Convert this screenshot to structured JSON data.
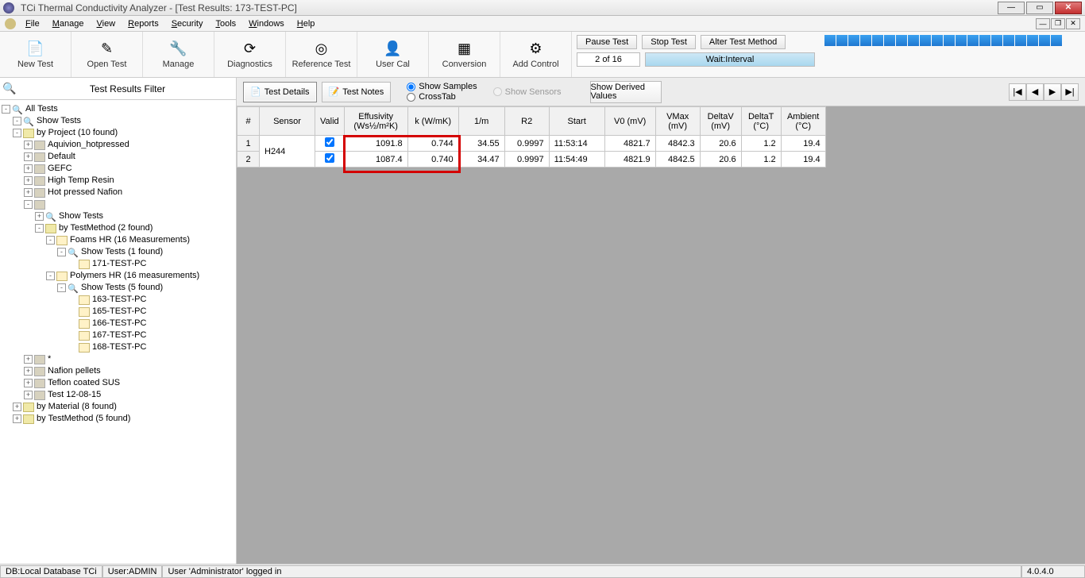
{
  "title": "TCi Thermal Conductivity Analyzer - [Test Results: 173-TEST-PC]",
  "menu": [
    "File",
    "Manage",
    "View",
    "Reports",
    "Security",
    "Tools",
    "Windows",
    "Help"
  ],
  "toolbar": [
    {
      "label": "New Test",
      "icon": "📄"
    },
    {
      "label": "Open Test",
      "icon": "✎"
    },
    {
      "label": "Manage",
      "icon": "🔧"
    },
    {
      "label": "Diagnostics",
      "icon": "⟳"
    },
    {
      "label": "Reference Test",
      "icon": "◎"
    },
    {
      "label": "User Cal",
      "icon": "👤"
    },
    {
      "label": "Conversion",
      "icon": "▦"
    },
    {
      "label": "Add Control",
      "icon": "⚙"
    }
  ],
  "right_buttons": {
    "pause": "Pause Test",
    "stop": "Stop Test",
    "alter": "Alter Test Method"
  },
  "status": {
    "count": "2 of 16",
    "wait": "Wait:Interval"
  },
  "filter_label": "Test Results Filter",
  "tree": [
    {
      "d": 0,
      "exp": "-",
      "icon": "search",
      "label": "All Tests"
    },
    {
      "d": 1,
      "exp": "-",
      "icon": "search",
      "label": "Show Tests"
    },
    {
      "d": 1,
      "exp": "-",
      "icon": "folder",
      "label": "by Project (10 found)"
    },
    {
      "d": 2,
      "exp": "+",
      "icon": "nicon",
      "label": "Aquivion_hotpressed"
    },
    {
      "d": 2,
      "exp": "+",
      "icon": "nicon",
      "label": "Default"
    },
    {
      "d": 2,
      "exp": "+",
      "icon": "nicon",
      "label": "GEFC"
    },
    {
      "d": 2,
      "exp": "+",
      "icon": "nicon",
      "label": "High Temp Resin"
    },
    {
      "d": 2,
      "exp": "+",
      "icon": "nicon",
      "label": "Hot pressed Nafion"
    },
    {
      "d": 2,
      "exp": "-",
      "icon": "nicon",
      "label": ""
    },
    {
      "d": 3,
      "exp": "+",
      "icon": "search",
      "label": "Show Tests"
    },
    {
      "d": 3,
      "exp": "-",
      "icon": "folder",
      "label": "by TestMethod (2 found)"
    },
    {
      "d": 4,
      "exp": "-",
      "icon": "doc",
      "label": "Foams HR (16 Measurements)"
    },
    {
      "d": 5,
      "exp": "-",
      "icon": "search",
      "label": "Show Tests (1 found)"
    },
    {
      "d": 6,
      "exp": " ",
      "icon": "doc",
      "label": "171-TEST-PC"
    },
    {
      "d": 4,
      "exp": "-",
      "icon": "doc",
      "label": "Polymers HR (16 measurements)"
    },
    {
      "d": 5,
      "exp": "-",
      "icon": "search",
      "label": "Show Tests (5 found)"
    },
    {
      "d": 6,
      "exp": " ",
      "icon": "doc",
      "label": "163-TEST-PC"
    },
    {
      "d": 6,
      "exp": " ",
      "icon": "doc",
      "label": "165-TEST-PC"
    },
    {
      "d": 6,
      "exp": " ",
      "icon": "doc",
      "label": "166-TEST-PC"
    },
    {
      "d": 6,
      "exp": " ",
      "icon": "doc",
      "label": "167-TEST-PC"
    },
    {
      "d": 6,
      "exp": " ",
      "icon": "doc",
      "label": "168-TEST-PC"
    },
    {
      "d": 2,
      "exp": "+",
      "icon": "nicon",
      "label": "*"
    },
    {
      "d": 2,
      "exp": "+",
      "icon": "nicon",
      "label": "Nafion pellets"
    },
    {
      "d": 2,
      "exp": "+",
      "icon": "nicon",
      "label": "Teflon coated SUS"
    },
    {
      "d": 2,
      "exp": "+",
      "icon": "nicon",
      "label": "Test 12-08-15"
    },
    {
      "d": 1,
      "exp": "+",
      "icon": "folder",
      "label": "by Material (8 found)"
    },
    {
      "d": 1,
      "exp": "+",
      "icon": "folder",
      "label": "by TestMethod (5 found)"
    }
  ],
  "tabs": {
    "details": "Test Details",
    "notes": "Test Notes"
  },
  "radios": {
    "samples": "Show Samples",
    "sensors": "Show Sensors",
    "crosstab": "CrossTab"
  },
  "derived": "Show Derived Values",
  "columns": [
    "#",
    "Sensor",
    "Valid",
    "Effusivity (Ws½/m²K)",
    "k (W/mK)",
    "1/m",
    "R2",
    "Start",
    "V0 (mV)",
    "VMax (mV)",
    "DeltaV (mV)",
    "DeltaT (°C)",
    "Ambient (°C)"
  ],
  "rows": [
    {
      "n": "1",
      "sensor": "H244",
      "valid": true,
      "eff": "1091.8",
      "k": "0.744",
      "im": "34.55",
      "r2": "0.9997",
      "start": "11:53:14",
      "v0": "4821.7",
      "vmax": "4842.3",
      "dv": "20.6",
      "dt": "1.2",
      "amb": "19.4"
    },
    {
      "n": "2",
      "sensor": "",
      "valid": true,
      "eff": "1087.4",
      "k": "0.740",
      "im": "34.47",
      "r2": "0.9997",
      "start": "11:54:49",
      "v0": "4821.9",
      "vmax": "4842.5",
      "dv": "20.6",
      "dt": "1.2",
      "amb": "19.4"
    }
  ],
  "statusbar": {
    "db": "DB:Local Database TCi",
    "user": "User:ADMIN",
    "msg": "User 'Administrator' logged in",
    "ver": "4.0.4.0"
  }
}
